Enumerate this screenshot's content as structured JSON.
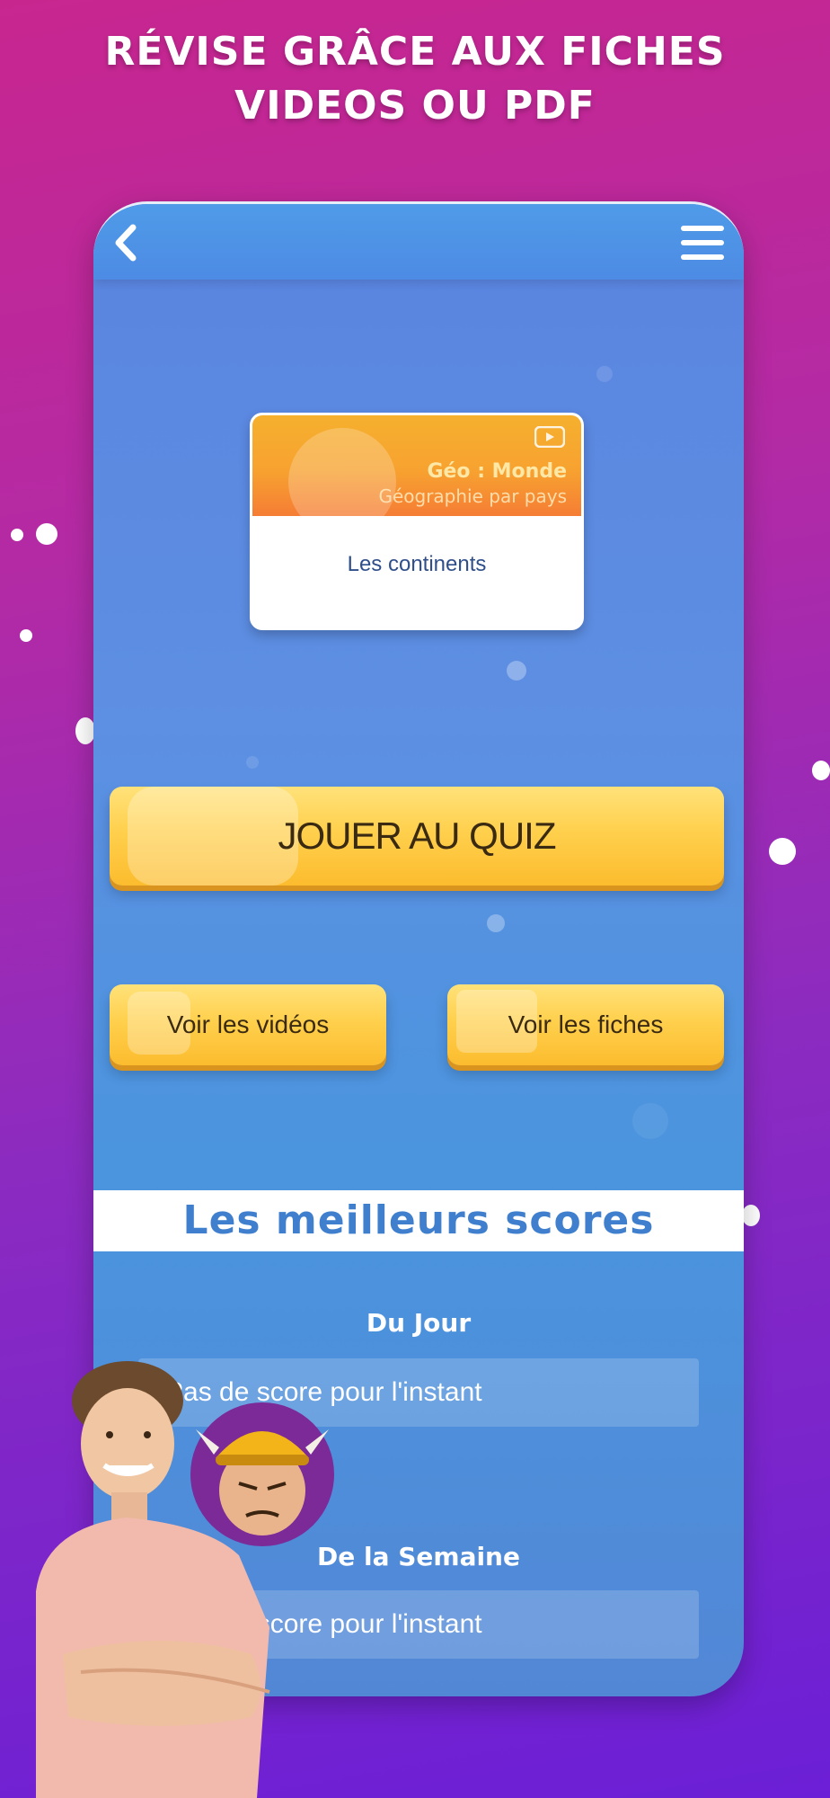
{
  "headline": {
    "line1": "RÉVISE GRÂCE AUX FICHES",
    "line2": "VIDEOS OU PDF"
  },
  "topbar": {
    "back_icon": "chevron-left-icon",
    "menu_icon": "hamburger-menu-icon"
  },
  "card": {
    "title": "Géo : Monde",
    "subtitle": "Géographie par pays",
    "label": "Les continents",
    "icon": "youtube-play-icon"
  },
  "buttons": {
    "quiz": "JOUER AU QUIZ",
    "videos": "Voir les vidéos",
    "fiches": "Voir les fiches"
  },
  "scores": {
    "title": "Les meilleurs scores",
    "daily": {
      "title": "Du Jour",
      "empty": "Pas de score pour l'instant"
    },
    "weekly": {
      "title": "De la Semaine",
      "empty": "Pas de score pour l'instant"
    }
  },
  "colors": {
    "accent_yellow": "#ffd04d",
    "header_blue": "#4f9be8",
    "scores_title_blue": "#3f7fcd"
  }
}
